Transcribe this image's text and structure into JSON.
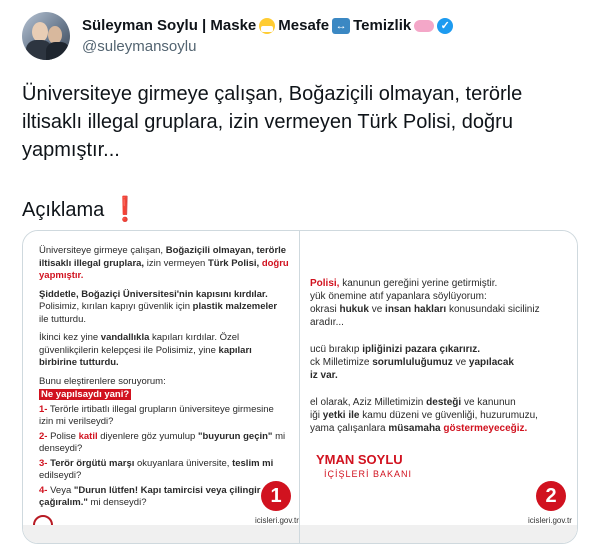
{
  "tweet": {
    "display_name": "Süleyman Soylu | Maske",
    "name_word2": "Mesafe",
    "name_word3": "Temizlik",
    "handle": "@suleymansoylu",
    "text": "Üniversiteye girmeye çalışan, Boğaziçili olmayan, terörle iltisaklı illegal gruplara, izin vermeyen Türk Polisi, doğru yapmıştır...",
    "aciklama": "Açıklama",
    "icons": [
      "mask-emoji-icon",
      "left-right-arrow-emoji-icon",
      "soap-emoji-icon",
      "verified-badge-icon",
      "exclamation-emoji-icon"
    ]
  },
  "card1": {
    "line1a": "Üniversiteye girmeye çalışan,",
    "line1b": "Boğaziçili olmayan, terörle iltisaklı illegal gruplara,",
    "line1c": "izin vermeyen",
    "line1d": "Türk Polisi,",
    "line1e": "doğru yapmıştır.",
    "p2a": "Şiddetle, Boğaziçi Üniversitesi'nin kapısını kırdılar.",
    "p2b": "Polisimiz, kırılan kapıyı güvenlik için",
    "p2c": "plastik malzemeler",
    "p2d": "ile tutturdu.",
    "p3a": "İkinci kez yine",
    "p3b": "vandallıkla",
    "p3c": "kapıları kırdılar.",
    "p3d": "Özel güvenlikçilerin kelepçesi ile Polisimiz, yine",
    "p3e": "kapıları birbirine tutturdu.",
    "q_intro": "Bunu eleştirenlere soruyorum:",
    "q_head": "Ne yapılsaydı yani?",
    "q1a": "1-",
    "q1b": "Terörle irtibatlı illegal grupların üniversiteye girmesine izin mi verilseydi?",
    "q2a": "2-",
    "q2b": "Polise",
    "q2c": "katil",
    "q2d": "diyenlere göz yumulup",
    "q2e": "\"buyurun geçin\"",
    "q2f": "mi denseydi?",
    "q3a": "3-",
    "q3b": "Terör örgütü marşı",
    "q3c": "okuyanlara üniversite,",
    "q3d": "teslim mi",
    "q3e": "edilseydi?",
    "q4a": "4-",
    "q4b": "Veya",
    "q4c": "\"Durun lütfen! Kapı tamircisi veya çilingir çağıralım.\"",
    "q4d": "mi denseydi?",
    "badge": "1",
    "site": "icisleri.gov.tr"
  },
  "card2": {
    "l1a": "Polisi,",
    "l1b": "kanunun gereğini yerine getirmiştir.",
    "l2": "yük önemine atıf yapanlara söylüyorum:",
    "l3a": "okrasi",
    "l3b": "hukuk",
    "l3c": "ve",
    "l3d": "insan hakları",
    "l3e": "konusundaki siciliniz",
    "l4": "aradır...",
    "l5a": "ucü bırakıp",
    "l5b": "ipliğinizi pazara çıkarırız.",
    "l6a": "ck Milletimize",
    "l6b": "sorumluluğumuz",
    "l6c": "ve",
    "l6d": "yapılacak",
    "l7": "iz var.",
    "l8a": "el olarak, Aziz Milletimizin",
    "l8b": "desteği",
    "l8c": "ve kanunun",
    "l9a": "iği",
    "l9b": "yetki ile",
    "l9c": "kamu düzeni ve güvenliği, huzurumuzu,",
    "l10a": "yama çalışanlara",
    "l10b": "müsamaha",
    "l10c": "göstermeyeceğiz.",
    "sig_name": "YMAN SOYLU",
    "sig_title": "İÇİŞLERİ BAKANI",
    "badge": "2",
    "site": "icisleri.gov.tr"
  }
}
